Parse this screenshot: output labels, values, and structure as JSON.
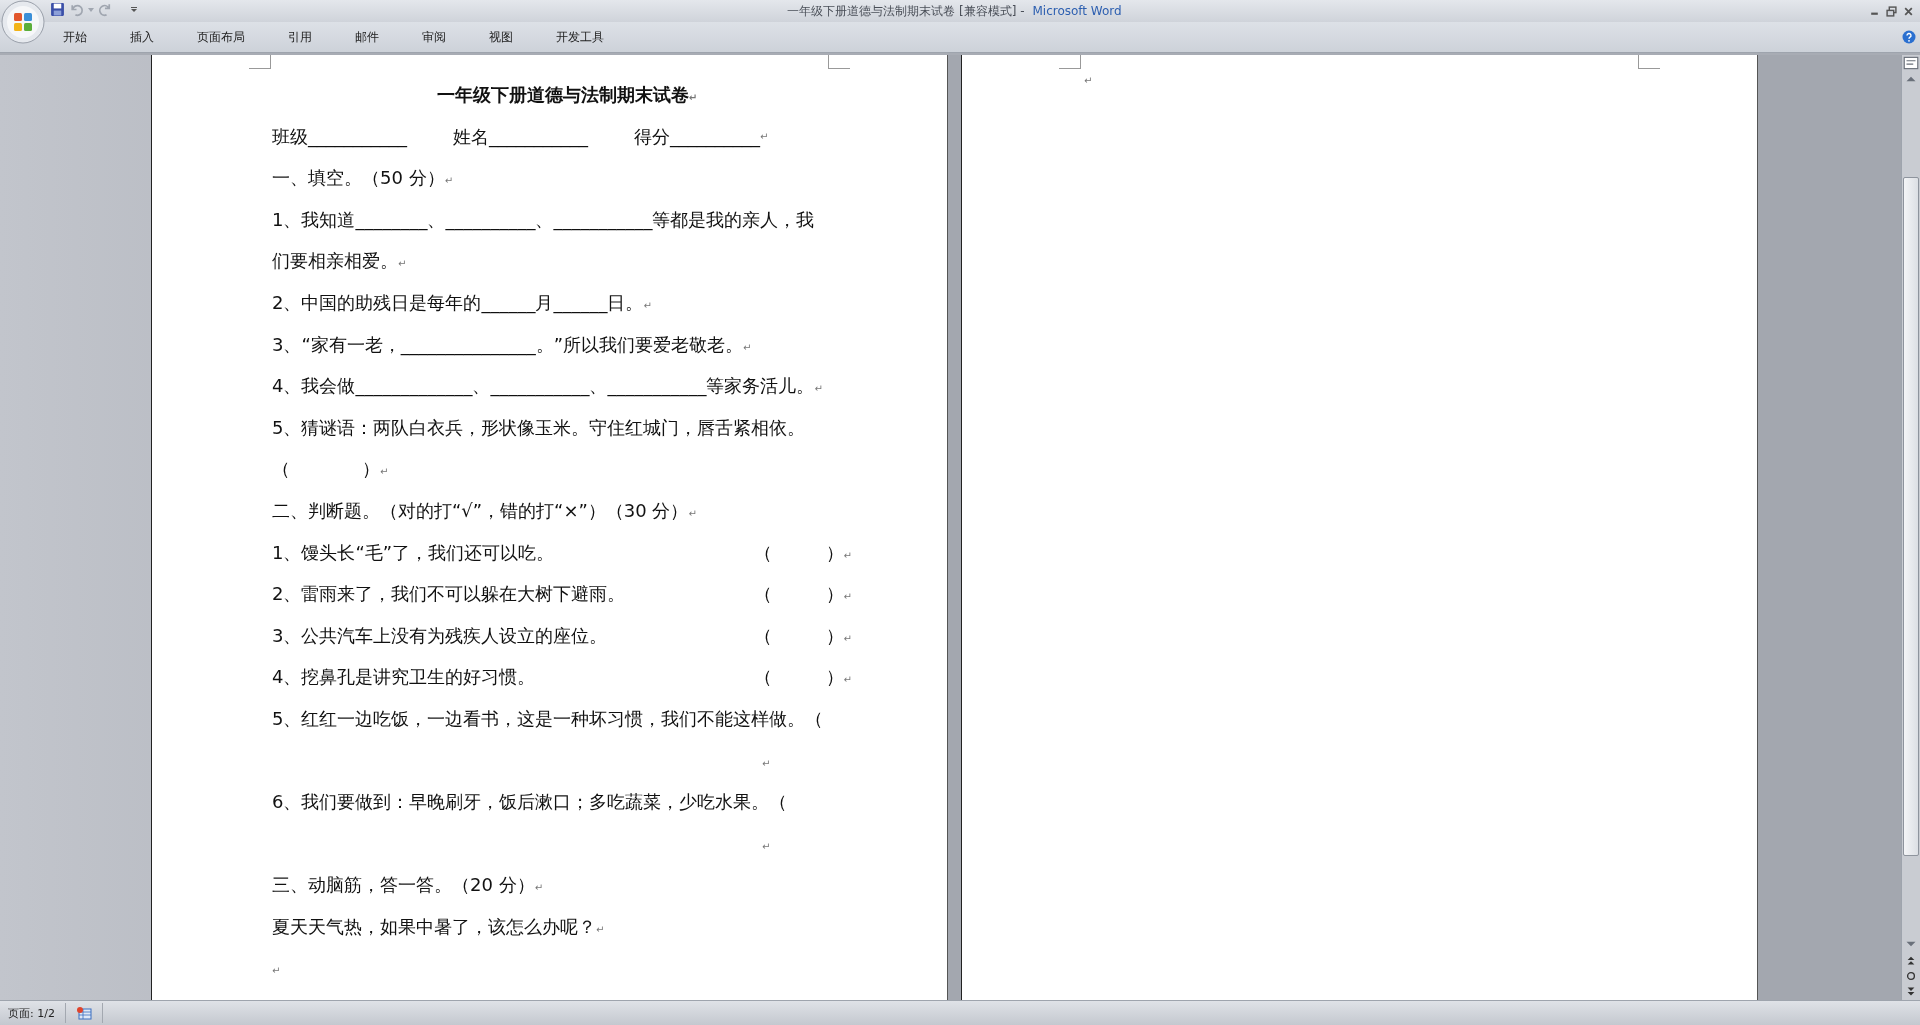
{
  "window": {
    "title": "一年级下册道德与法制期末试卷 [兼容模式] -",
    "app": "Microsoft Word"
  },
  "ribbon_tabs": [
    {
      "label": "开始",
      "selected": false
    },
    {
      "label": "插入",
      "selected": false
    },
    {
      "label": "页面布局",
      "selected": false
    },
    {
      "label": "引用",
      "selected": false
    },
    {
      "label": "邮件",
      "selected": false
    },
    {
      "label": "审阅",
      "selected": false
    },
    {
      "label": "视图",
      "selected": false
    },
    {
      "label": "开发工具",
      "selected": false
    }
  ],
  "pages": [
    {
      "paragraphs": [
        {
          "kind": "title",
          "lines": [
            "一年级下册道德与法制期末试卷"
          ],
          "mark": "↵"
        },
        {
          "kind": "fields",
          "items": [
            "班级___________",
            "姓名___________",
            "得分__________"
          ],
          "mark": "↵"
        },
        {
          "kind": "text",
          "lines": [
            "一、填空。（50 分）"
          ],
          "mark": "↵"
        },
        {
          "kind": "text",
          "lines": [
            "1、我知道________、__________、___________等都是我的亲人，我",
            "们要相亲相爱。"
          ],
          "mark": "↵"
        },
        {
          "kind": "text",
          "lines": [
            "2、中国的助残日是每年的______月______日。"
          ],
          "mark": "↵"
        },
        {
          "kind": "text",
          "lines": [
            "3、“家有一老，_______________。”所以我们要爱老敬老。"
          ],
          "mark": "↵"
        },
        {
          "kind": "text",
          "lines": [
            "4、我会做_____________、___________、___________等家务活儿。"
          ],
          "mark": "↵"
        },
        {
          "kind": "text",
          "lines": [
            "5、猜谜语：两队白衣兵，形状像玉米。守住红城门，唇舌紧相依。",
            "（　　　　）"
          ],
          "mark": "↵"
        },
        {
          "kind": "text",
          "lines": [
            "二、判断题。（对的打“√”，错的打“×”）（30 分）"
          ],
          "mark": "↵"
        },
        {
          "kind": "judge",
          "lines": [
            "1、馒头长“毛”了，我们还可以吃。"
          ],
          "answer": "（　　　）",
          "mark": "↵"
        },
        {
          "kind": "judge",
          "lines": [
            "2、雷雨来了，我们不可以躲在大树下避雨。"
          ],
          "answer": "（　　　）",
          "mark": "↵"
        },
        {
          "kind": "judge",
          "lines": [
            "3、公共汽车上没有为残疾人设立的座位。"
          ],
          "answer": "（　　　）",
          "mark": "↵"
        },
        {
          "kind": "judge",
          "lines": [
            "4、挖鼻孔是讲究卫生的好习惯。"
          ],
          "answer": "（　　　）",
          "mark": "↵"
        },
        {
          "kind": "open",
          "lines": [
            "5、红红一边吃饭，一边看书，这是一种坏习惯，我们不能这样做。（"
          ],
          "mark": "↵"
        },
        {
          "kind": "open",
          "lines": [
            "6、我们要做到：早晚刷牙，饭后漱口；多吃蔬菜，少吃水果。（"
          ],
          "mark": "↵"
        },
        {
          "kind": "text",
          "lines": [
            "三、动脑筋，答一答。（20 分）"
          ],
          "mark": "↵"
        },
        {
          "kind": "text",
          "lines": [
            "夏天天气热，如果中暑了，该怎么办呢？"
          ],
          "mark": "↵"
        },
        {
          "kind": "empty",
          "mark": "↵"
        }
      ]
    },
    {
      "paragraphs": [
        {
          "kind": "empty",
          "mark": "↵"
        }
      ]
    }
  ],
  "status_bar": {
    "page": "页面: 1/2"
  }
}
